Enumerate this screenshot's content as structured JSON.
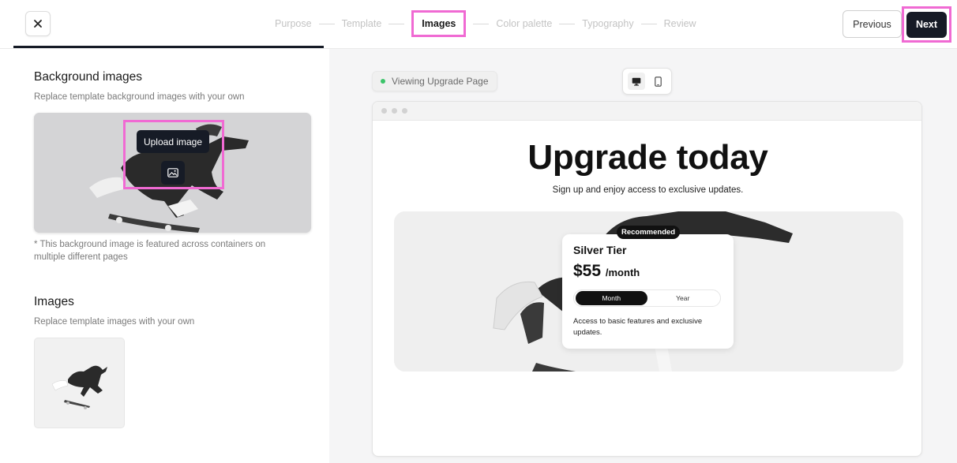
{
  "header": {
    "steps": [
      {
        "label": "Purpose",
        "active": false
      },
      {
        "label": "Template",
        "active": false
      },
      {
        "label": "Images",
        "active": true
      },
      {
        "label": "Color palette",
        "active": false
      },
      {
        "label": "Typography",
        "active": false
      },
      {
        "label": "Review",
        "active": false
      }
    ],
    "previous_label": "Previous",
    "next_label": "Next"
  },
  "left_panel": {
    "background_section": {
      "title": "Background images",
      "subtitle": "Replace template background images with your own",
      "upload_tooltip": "Upload image",
      "note": "* This background image is featured across containers on multiple different pages"
    },
    "images_section": {
      "title": "Images",
      "subtitle": "Replace template images with your own"
    }
  },
  "preview": {
    "viewing_label": "Viewing Upgrade Page",
    "hero_title": "Upgrade today",
    "hero_subtitle": "Sign up and enjoy access to exclusive updates.",
    "card": {
      "badge": "Recommended",
      "tier": "Silver Tier",
      "price": "$55",
      "period": "/month",
      "toggle_month": "Month",
      "toggle_year": "Year",
      "description": "Access to basic features and exclusive updates."
    }
  },
  "colors": {
    "highlight": "#f06ad3",
    "primary_dark": "#161b26",
    "status_green": "#3cc46a"
  }
}
